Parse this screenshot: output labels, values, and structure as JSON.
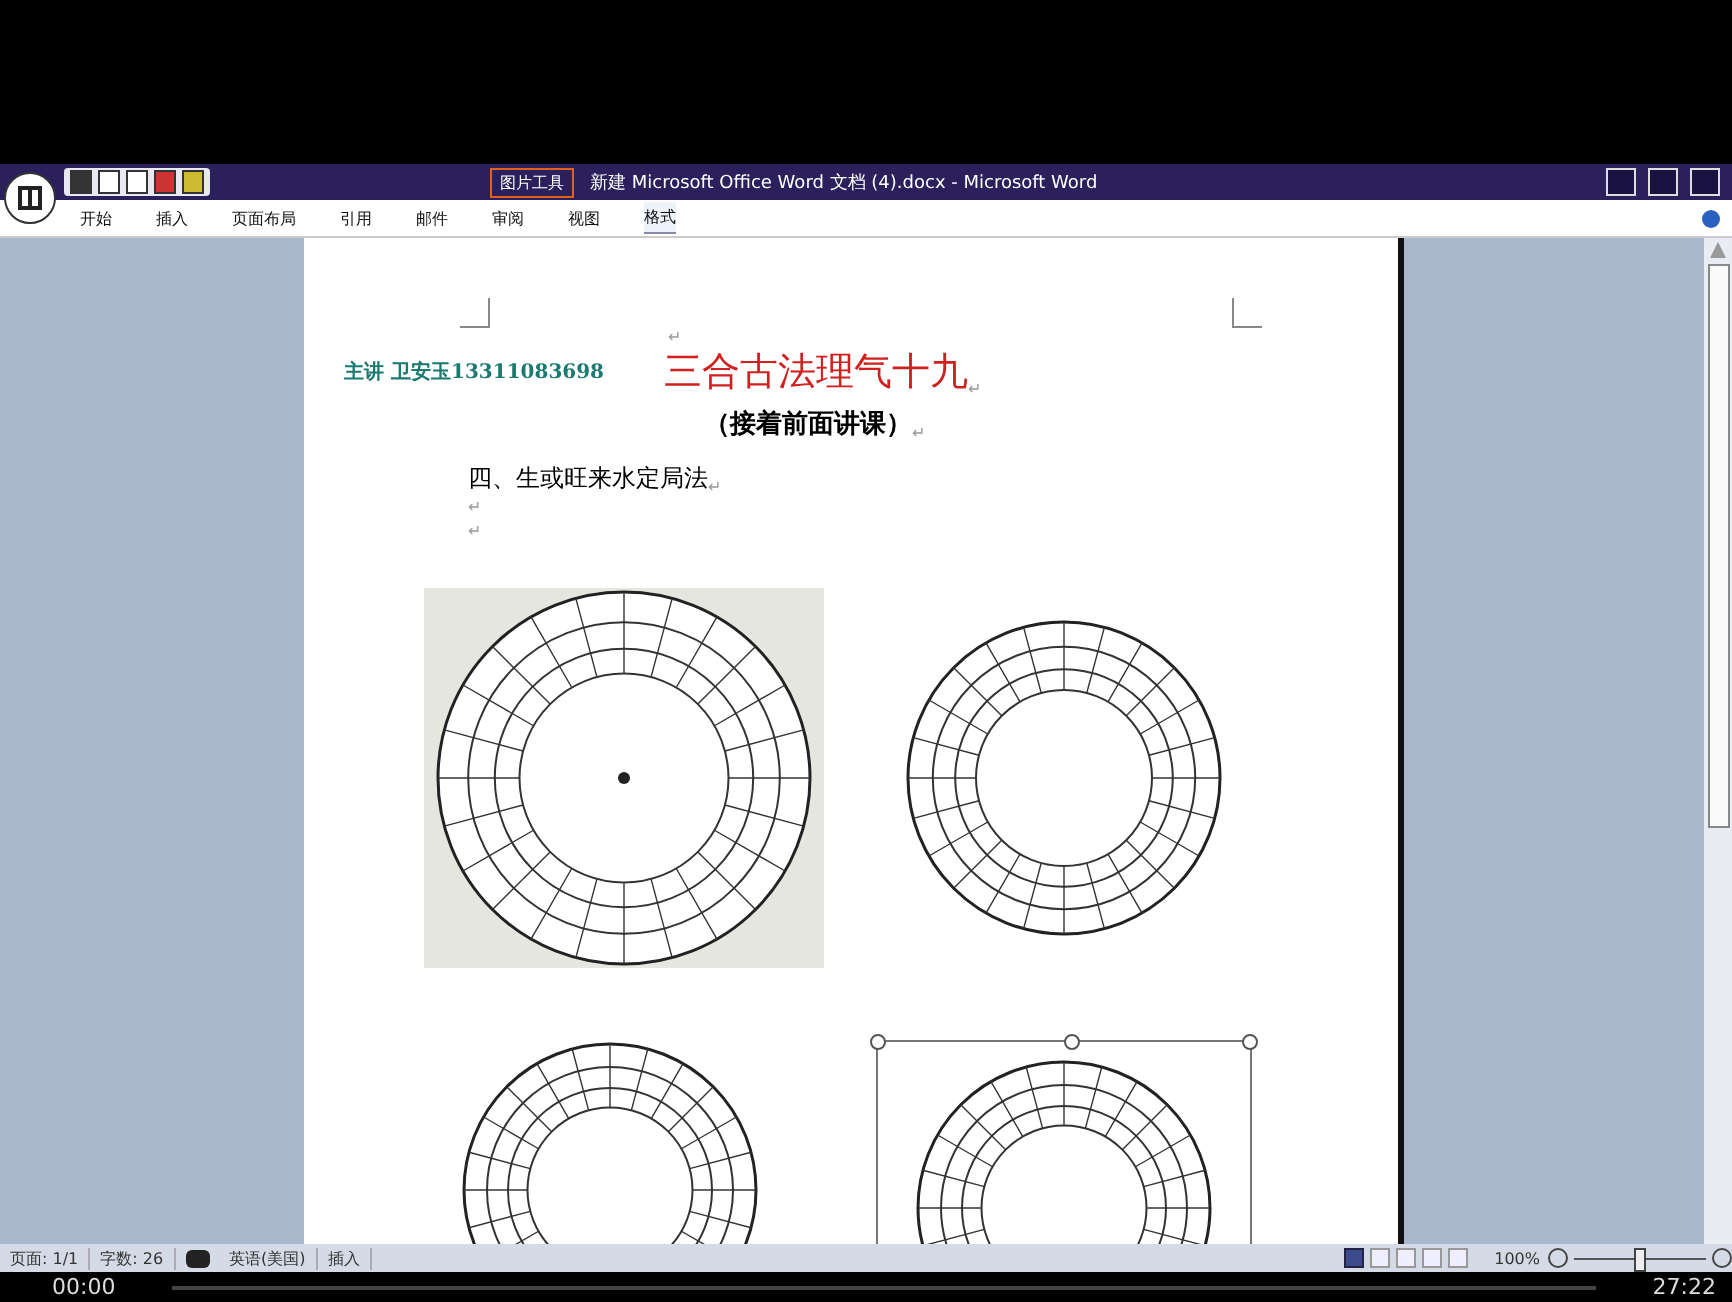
{
  "window": {
    "title": "新建 Microsoft Office Word 文档 (4).docx - Microsoft Word",
    "context_tab": "图片工具"
  },
  "ribbon": {
    "tabs": [
      {
        "label": "开始",
        "selected": false
      },
      {
        "label": "插入",
        "selected": false
      },
      {
        "label": "页面布局",
        "selected": false
      },
      {
        "label": "引用",
        "selected": false
      },
      {
        "label": "邮件",
        "selected": false
      },
      {
        "label": "审阅",
        "selected": false
      },
      {
        "label": "视图",
        "selected": false
      },
      {
        "label": "格式",
        "selected": true
      }
    ]
  },
  "document": {
    "byline": "主讲 卫安玉13311083698",
    "title": "三合古法理气十九",
    "subtitle": "（接着前面讲课）",
    "heading": "四、生或旺来水定局法",
    "paragraph_mark": "↵",
    "empty_paragraphs": [
      "↵",
      "↵"
    ]
  },
  "status_bar": {
    "items": [
      "页面: 1/1",
      "字数: 26"
    ],
    "language": "英语(美国)",
    "mode": "插入",
    "views": [
      {
        "selected": true
      },
      {
        "selected": false
      },
      {
        "selected": false
      },
      {
        "selected": false
      },
      {
        "selected": false
      }
    ],
    "zoom": "100%",
    "zoom_slider": {
      "level": 0.5
    }
  },
  "player": {
    "elapsed": "00:00",
    "duration": "27:22"
  }
}
